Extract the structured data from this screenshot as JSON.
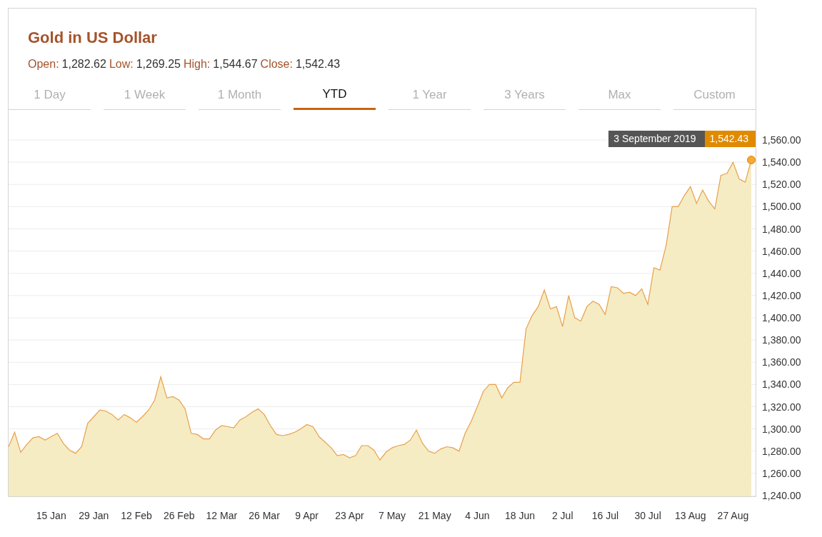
{
  "title": "Gold in US Dollar",
  "stats": [
    {
      "label": "Open:",
      "value": "1,282.62"
    },
    {
      "label": "Low:",
      "value": "1,269.25"
    },
    {
      "label": "High:",
      "value": "1,544.67"
    },
    {
      "label": "Close:",
      "value": "1,542.43"
    }
  ],
  "tabs": [
    {
      "label": "1 Day",
      "selected": false
    },
    {
      "label": "1 Week",
      "selected": false
    },
    {
      "label": "1 Month",
      "selected": false
    },
    {
      "label": "YTD",
      "selected": true
    },
    {
      "label": "1 Year",
      "selected": false
    },
    {
      "label": "3 Years",
      "selected": false
    },
    {
      "label": "Max",
      "selected": false
    },
    {
      "label": "Custom",
      "selected": false
    }
  ],
  "tooltip": {
    "date": "3 September 2019",
    "value": "1,542.43"
  },
  "chart_data": {
    "type": "area",
    "grid": true,
    "ylim": [
      1240,
      1560
    ],
    "yticks": [
      {
        "value": 1240,
        "label": "1,240.00"
      },
      {
        "value": 1260,
        "label": "1,260.00"
      },
      {
        "value": 1280,
        "label": "1,280.00"
      },
      {
        "value": 1300,
        "label": "1,300.00"
      },
      {
        "value": 1320,
        "label": "1,320.00"
      },
      {
        "value": 1340,
        "label": "1,340.00"
      },
      {
        "value": 1360,
        "label": "1,360.00"
      },
      {
        "value": 1380,
        "label": "1,380.00"
      },
      {
        "value": 1400,
        "label": "1,400.00"
      },
      {
        "value": 1420,
        "label": "1,420.00"
      },
      {
        "value": 1440,
        "label": "1,440.00"
      },
      {
        "value": 1460,
        "label": "1,460.00"
      },
      {
        "value": 1480,
        "label": "1,480.00"
      },
      {
        "value": 1500,
        "label": "1,500.00"
      },
      {
        "value": 1520,
        "label": "1,520.00"
      },
      {
        "value": 1540,
        "label": "1,540.00"
      },
      {
        "value": 1560,
        "label": "1,560.00"
      }
    ],
    "categories": [
      null,
      null,
      null,
      null,
      null,
      null,
      null,
      "15 Jan",
      null,
      null,
      null,
      null,
      null,
      null,
      "29 Jan",
      null,
      null,
      null,
      null,
      null,
      null,
      "12 Feb",
      null,
      null,
      null,
      null,
      null,
      null,
      "26 Feb",
      null,
      null,
      null,
      null,
      null,
      null,
      "12 Mar",
      null,
      null,
      null,
      null,
      null,
      null,
      "26 Mar",
      null,
      null,
      null,
      null,
      null,
      null,
      "9 Apr",
      null,
      null,
      null,
      null,
      null,
      null,
      "23 Apr",
      null,
      null,
      null,
      null,
      null,
      null,
      "7 May",
      null,
      null,
      null,
      null,
      null,
      null,
      "21 May",
      null,
      null,
      null,
      null,
      null,
      null,
      "4 Jun",
      null,
      null,
      null,
      null,
      null,
      null,
      "18 Jun",
      null,
      null,
      null,
      null,
      null,
      null,
      "2 Jul",
      null,
      null,
      null,
      null,
      null,
      null,
      "16 Jul",
      null,
      null,
      null,
      null,
      null,
      null,
      "30 Jul",
      null,
      null,
      null,
      null,
      null,
      null,
      "13 Aug",
      null,
      null,
      null,
      null,
      null,
      null,
      "27 Aug",
      null,
      null,
      null
    ],
    "series": [
      {
        "color": "#e8a04a",
        "values": [
          1284,
          1297,
          1279,
          1286,
          1292,
          1293,
          1290,
          1293,
          1296,
          1287,
          1281,
          1278,
          1284,
          1305,
          1311,
          1317,
          1316,
          1313,
          1308,
          1313,
          1310,
          1306,
          1311,
          1317,
          1326,
          1347,
          1328,
          1329,
          1326,
          1318,
          1296,
          1295,
          1291,
          1291,
          1299,
          1303,
          1302,
          1301,
          1308,
          1311,
          1315,
          1318,
          1313,
          1303,
          1295,
          1294,
          1295,
          1297,
          1300,
          1304,
          1302,
          1293,
          1288,
          1283,
          1276,
          1277,
          1274,
          1276,
          1285,
          1285,
          1281,
          1272,
          1279,
          1283,
          1285,
          1286,
          1290,
          1299,
          1287,
          1280,
          1278,
          1282,
          1284,
          1283,
          1280,
          1296,
          1307,
          1320,
          1334,
          1340,
          1340,
          1328,
          1337,
          1342,
          1342,
          1390,
          1402,
          1410,
          1425,
          1408,
          1410,
          1392,
          1420,
          1400,
          1397,
          1410,
          1415,
          1412,
          1403,
          1428,
          1427,
          1422,
          1423,
          1420,
          1426,
          1412,
          1445,
          1443,
          1465,
          1500,
          1500,
          1510,
          1518,
          1503,
          1515,
          1505,
          1498,
          1528,
          1530,
          1540,
          1525,
          1522,
          1542
        ]
      }
    ]
  }
}
